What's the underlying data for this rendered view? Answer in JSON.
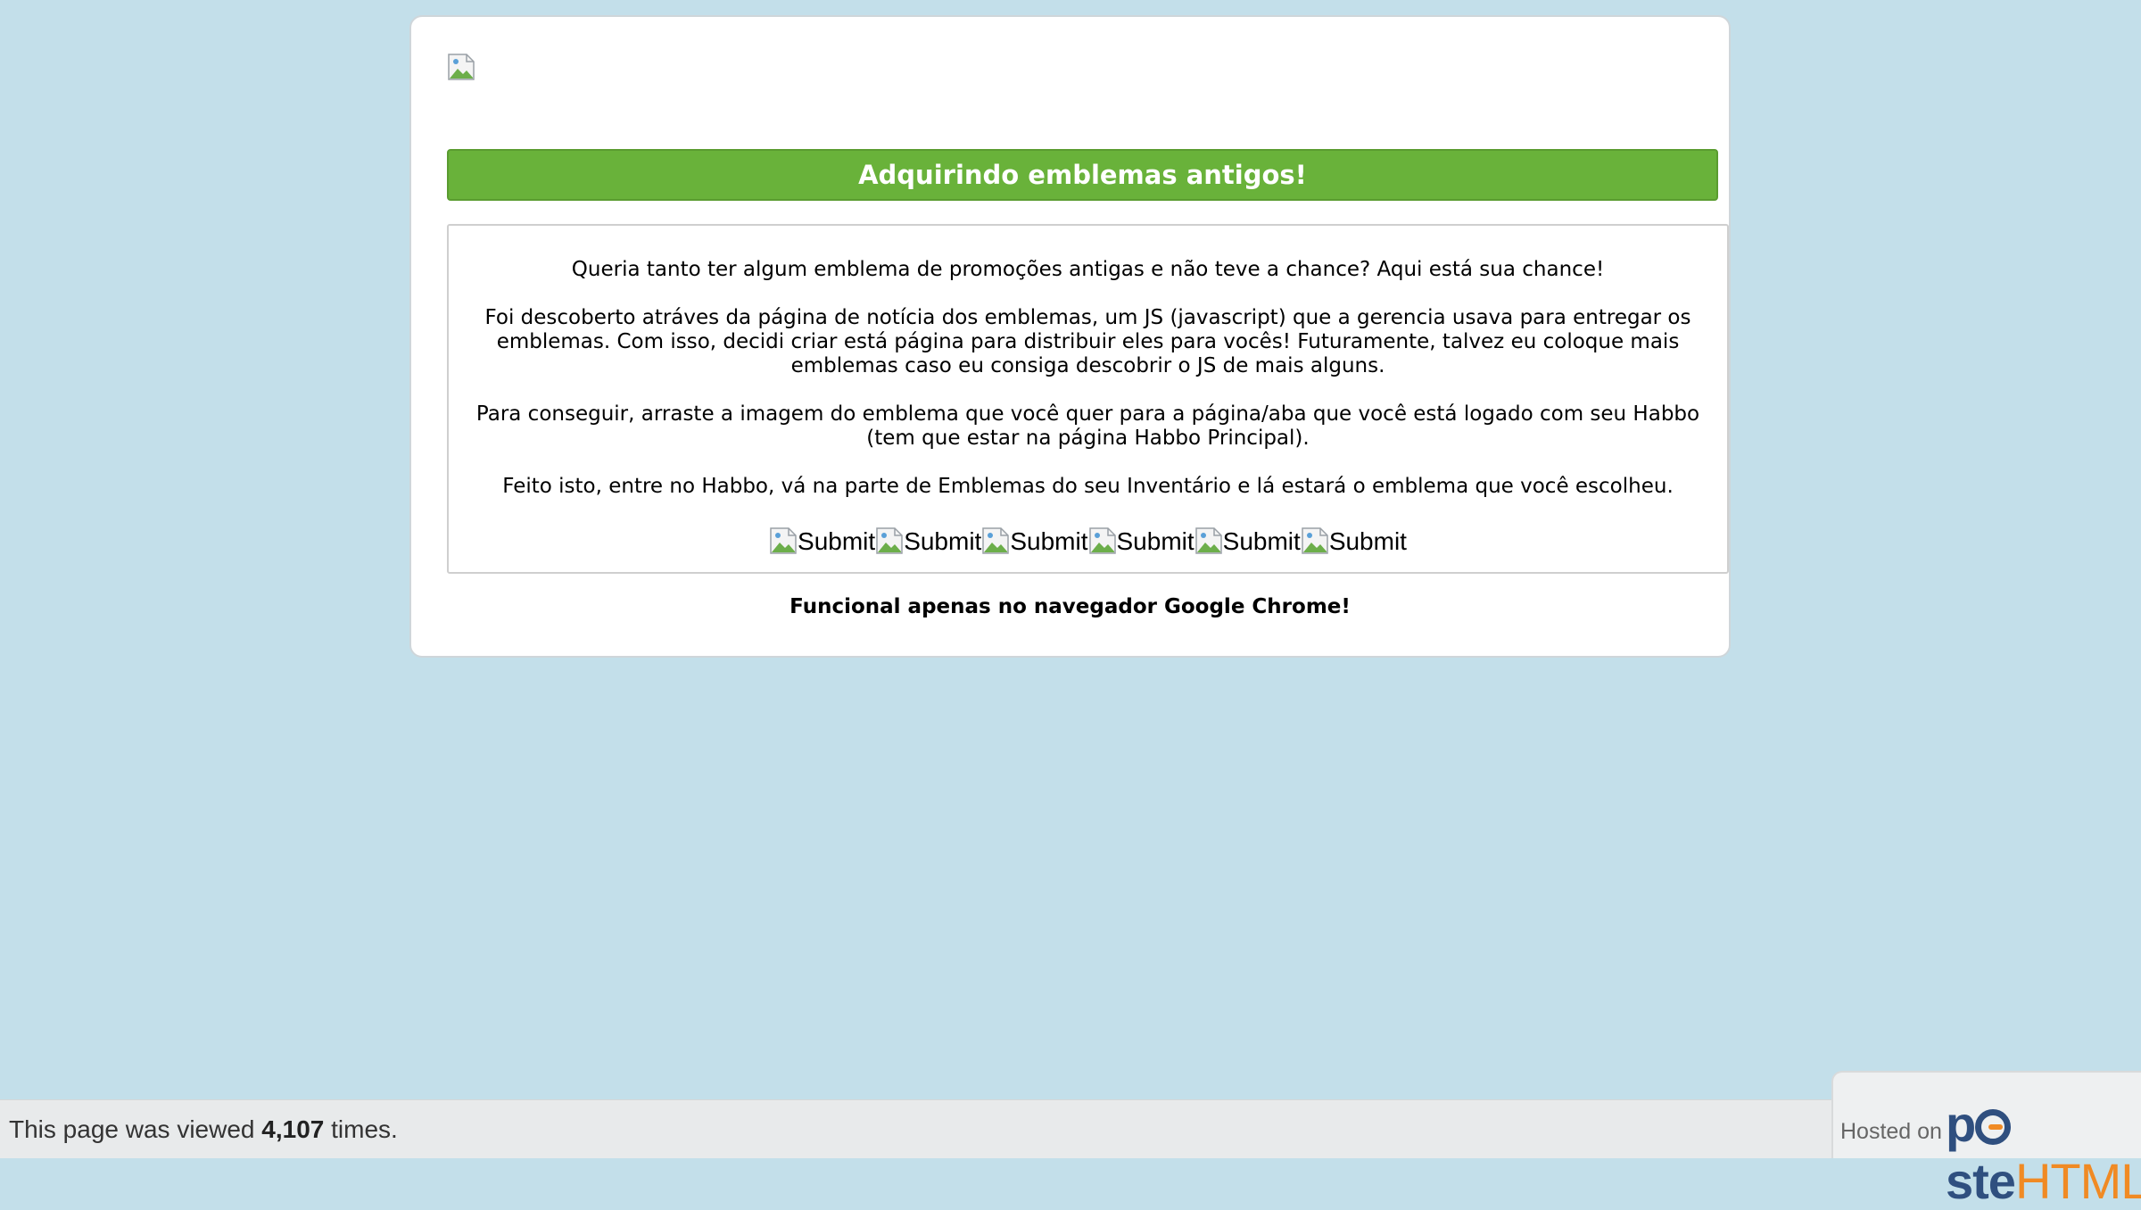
{
  "card": {
    "logo_alt": "",
    "title": "Adquirindo emblemas antigos!",
    "paragraphs": [
      "Queria tanto ter algum emblema de promoções antigas e não teve a chance? Aqui está sua chance!",
      "Foi descoberto atráves da página de notícia dos emblemas, um JS (javascript) que a gerencia usava para entregar os emblemas. Com isso, decidi criar está página para distribuir eles para vocês! Futuramente, talvez eu coloque mais emblemas caso eu consiga descobrir o JS de mais alguns.",
      "Para conseguir, arraste a imagem do emblema que você quer para a página/aba que você está logado com seu Habbo (tem que estar na página Habbo Principal).",
      "Feito isto, entre no Habbo, vá na parte de Emblemas do seu Inventário e lá estará o emblema que você escolheu."
    ],
    "badges": [
      {
        "label": "Submit"
      },
      {
        "label": "Submit"
      },
      {
        "label": "Submit"
      },
      {
        "label": "Submit"
      },
      {
        "label": "Submit"
      },
      {
        "label": "Submit"
      }
    ],
    "footer_note": "Funcional apenas no navegador Google Chrome!"
  },
  "bottom_bar": {
    "views_prefix": "This page was viewed ",
    "views_count": "4,107",
    "views_suffix": " times.",
    "hosted_on": "Hosted on",
    "brand_part1": "p",
    "brand_part2": "ste",
    "brand_part3": "HTML"
  },
  "colors": {
    "page_background": "#c3dfea",
    "title_bar": "#69b23a",
    "brand_blue": "#2f4f7f",
    "brand_orange": "#f08a24"
  }
}
